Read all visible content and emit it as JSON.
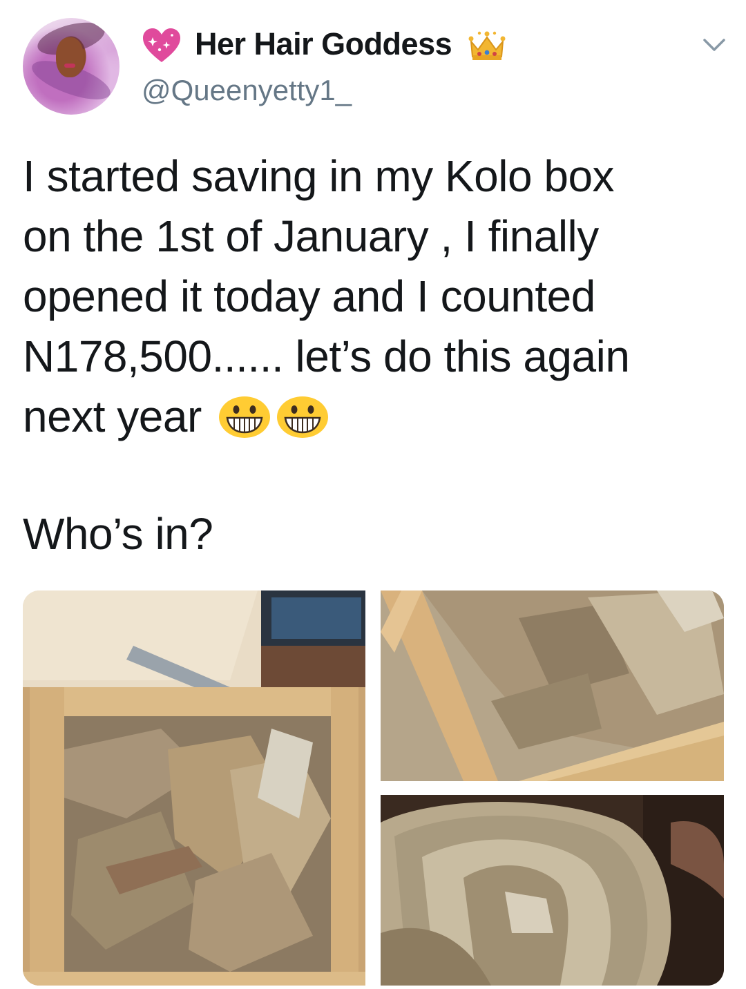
{
  "tweet": {
    "display_name": "Her Hair Goddess",
    "handle": "@Queenyetty1_",
    "text": "I started saving in my Kolo box\non the 1st of January , I finally\nopened it today and I counted\nN178,500...... let’s do this again\nnext year ",
    "question": "Who’s in?"
  },
  "icons": {
    "name_prefix": "sparkling-heart-icon",
    "name_suffix": "crown-icon",
    "menu": "chevron-down-icon",
    "text_emoji": [
      "grinning-face-icon",
      "grinning-face-icon"
    ]
  },
  "colors": {
    "text": "#14171a",
    "secondary_text": "#657786",
    "heart": "#e04a9c",
    "crown": "#f2b632",
    "emoji": "#ffcc33"
  },
  "media": {
    "photos": [
      "kolo-box-with-banknotes",
      "banknotes-in-box-closeup",
      "stack-of-banknotes"
    ]
  }
}
